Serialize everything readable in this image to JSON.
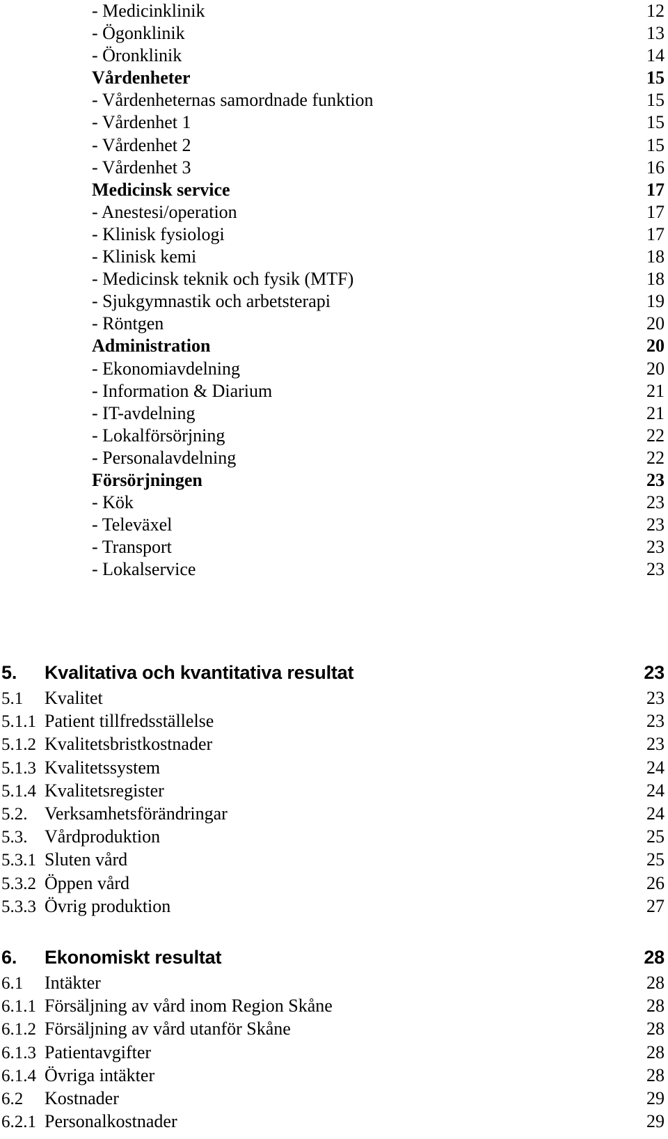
{
  "document": {
    "kind": "table-of-contents",
    "language": "sv"
  },
  "toc_list": {
    "items": [
      {
        "label": "- Medicinklinik",
        "page": "12",
        "bold": false
      },
      {
        "label": "- Ögonklinik",
        "page": "13",
        "bold": false
      },
      {
        "label": "- Öronklinik",
        "page": "14",
        "bold": false
      },
      {
        "label": "Vårdenheter",
        "page": "15",
        "bold": true
      },
      {
        "label": "- Vårdenheternas samordnade funktion",
        "page": "15",
        "bold": false
      },
      {
        "label": "- Vårdenhet 1",
        "page": "15",
        "bold": false
      },
      {
        "label": "- Vårdenhet 2",
        "page": "15",
        "bold": false
      },
      {
        "label": "- Vårdenhet 3",
        "page": "16",
        "bold": false
      },
      {
        "label": "Medicinsk service",
        "page": "17",
        "bold": true
      },
      {
        "label": "- Anestesi/operation",
        "page": "17",
        "bold": false
      },
      {
        "label": "- Klinisk fysiologi",
        "page": "17",
        "bold": false
      },
      {
        "label": "- Klinisk kemi",
        "page": "18",
        "bold": false
      },
      {
        "label": "- Medicinsk teknik och fysik (MTF)",
        "page": "18",
        "bold": false
      },
      {
        "label": "- Sjukgymnastik och arbetsterapi",
        "page": "19",
        "bold": false
      },
      {
        "label": "- Röntgen",
        "page": "20",
        "bold": false
      },
      {
        "label": "Administration",
        "page": "20",
        "bold": true
      },
      {
        "label": "- Ekonomiavdelning",
        "page": "20",
        "bold": false
      },
      {
        "label": "- Information & Diarium",
        "page": "21",
        "bold": false
      },
      {
        "label": "- IT-avdelning",
        "page": "21",
        "bold": false
      },
      {
        "label": "- Lokalförsörjning",
        "page": "22",
        "bold": false
      },
      {
        "label": "- Personalavdelning",
        "page": "22",
        "bold": false
      },
      {
        "label": "Försörjningen",
        "page": "23",
        "bold": true
      },
      {
        "label": "- Kök",
        "page": "23",
        "bold": false
      },
      {
        "label": "- Televäxel",
        "page": "23",
        "bold": false
      },
      {
        "label": "- Transport",
        "page": "23",
        "bold": false
      },
      {
        "label": "- Lokalservice",
        "page": "23",
        "bold": false
      }
    ]
  },
  "section5": {
    "rows": [
      {
        "number": "5.",
        "title": "Kvalitativa och kvantitativa resultat",
        "page": "23",
        "major": true
      },
      {
        "number": "5.1",
        "title": "Kvalitet",
        "page": "23",
        "major": false
      },
      {
        "number": "5.1.1",
        "title": "Patient tillfredsställelse",
        "page": "23",
        "major": false
      },
      {
        "number": "5.1.2",
        "title": "Kvalitetsbristkostnader",
        "page": "23",
        "major": false
      },
      {
        "number": "5.1.3",
        "title": "Kvalitetssystem",
        "page": "24",
        "major": false
      },
      {
        "number": "5.1.4",
        "title": "Kvalitetsregister",
        "page": "24",
        "major": false
      },
      {
        "number": "5.2.",
        "title": "Verksamhetsförändringar",
        "page": "24",
        "major": false
      },
      {
        "number": "5.3.",
        "title": "Vårdproduktion",
        "page": "25",
        "major": false
      },
      {
        "number": "5.3.1",
        "title": "Sluten vård",
        "page": "25",
        "major": false
      },
      {
        "number": "5.3.2",
        "title": "Öppen vård",
        "page": "26",
        "major": false
      },
      {
        "number": "5.3.3",
        "title": "Övrig produktion",
        "page": "27",
        "major": false
      }
    ]
  },
  "section6": {
    "rows": [
      {
        "number": "6.",
        "title": "Ekonomiskt resultat",
        "page": "28",
        "major": true
      },
      {
        "number": "6.1",
        "title": "Intäkter",
        "page": "28",
        "major": false
      },
      {
        "number": "6.1.1",
        "title": "Försäljning av vård inom Region Skåne",
        "page": "28",
        "major": false
      },
      {
        "number": "6.1.2",
        "title": "Försäljning av vård utanför Skåne",
        "page": "28",
        "major": false
      },
      {
        "number": "6.1.3",
        "title": "Patientavgifter",
        "page": "28",
        "major": false
      },
      {
        "number": "6.1.4",
        "title": "Övriga intäkter",
        "page": "28",
        "major": false
      },
      {
        "number": "6.2",
        "title": "Kostnader",
        "page": "29",
        "major": false
      },
      {
        "number": "6.2.1",
        "title": "Personalkostnader",
        "page": "29",
        "major": false
      }
    ]
  },
  "colors": {
    "text": "#000000",
    "background": "#ffffff"
  }
}
